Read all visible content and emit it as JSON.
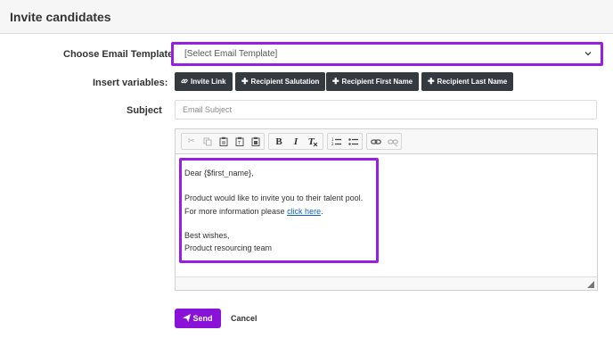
{
  "dialog": {
    "title": "Invite candidates"
  },
  "form": {
    "template_label": "Choose Email Template",
    "template_selected": "[Select Email Template]",
    "variables_label": "Insert variables:",
    "subject_label": "Subject",
    "subject_placeholder": "Email Subject",
    "subject_value": ""
  },
  "variables": [
    {
      "label": "Invite Link",
      "icon": "link-icon"
    },
    {
      "label": "Recipient Salutation",
      "icon": "plus-icon"
    },
    {
      "label": "Recipient First Name",
      "icon": "plus-icon"
    },
    {
      "label": "Recipient Last Name",
      "icon": "plus-icon"
    }
  ],
  "toolbar": {
    "tools": [
      "cut-icon",
      "copy-icon",
      "paste-icon",
      "paste-text-icon",
      "paste-word-icon",
      "bold-icon",
      "italic-icon",
      "remove-format-icon",
      "numbered-list-icon",
      "bulleted-list-icon",
      "link-icon",
      "unlink-icon"
    ],
    "bold_glyph": "B",
    "italic_glyph": "I"
  },
  "email_body": {
    "greeting": "Dear {$first_name},",
    "line1": "Product would like to invite you to their talent pool.",
    "line2_prefix": "For more information please ",
    "link_text": "click here",
    "line2_suffix": ".",
    "signoff": "Best wishes,",
    "signature": "Product resourcing team"
  },
  "actions": {
    "send_label": "Send",
    "cancel_label": "Cancel"
  },
  "colors": {
    "accent": "#8a12d8",
    "highlight": "#9a1ee0",
    "variable_button": "#343a40",
    "link": "#0b66c2"
  }
}
